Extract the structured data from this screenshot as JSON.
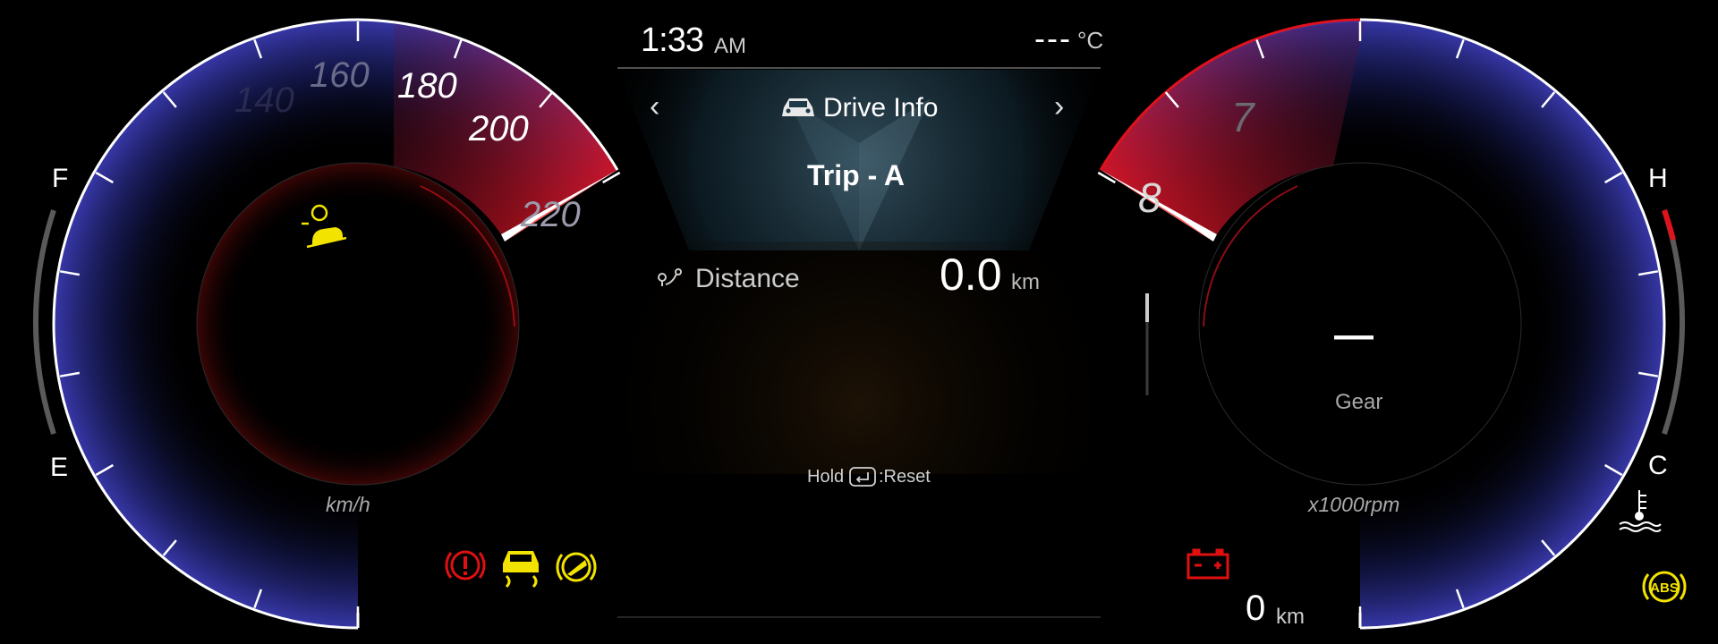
{
  "clock": {
    "time": "1:33",
    "ampm": "AM"
  },
  "outside_temp": {
    "value": "---",
    "unit": "°C"
  },
  "info_panel": {
    "title": "Drive Info",
    "prev_arrow": "‹",
    "next_arrow": "›",
    "subtitle": "Trip - A",
    "distance_label": "Distance",
    "distance_value": "0.0",
    "distance_unit": "km",
    "reset_hold": "Hold",
    "reset_action": ":Reset"
  },
  "speedometer": {
    "unit": "km/h",
    "tick_labels": [
      "140",
      "160",
      "180",
      "200",
      "220"
    ]
  },
  "tachometer": {
    "unit": "x1000rpm",
    "tick_labels": [
      "7",
      "8"
    ],
    "gear_value": "—",
    "gear_label": "Gear"
  },
  "fuel_gauge": {
    "full_label": "F",
    "empty_label": "E"
  },
  "temp_gauge": {
    "hot_label": "H",
    "cold_label": "C"
  },
  "odometer": {
    "value": "0",
    "unit": "km"
  },
  "warning_lights": {
    "left_panel": [
      "hill-descent-icon"
    ],
    "bottom_left": [
      "brake-warning-icon",
      "traction-control-icon",
      "parking-brake-icon"
    ],
    "bottom_right": [
      "battery-warning-icon",
      "abs-warning-icon"
    ],
    "temp": "coolant-temperature-icon"
  },
  "colors": {
    "accent_red": "#e0121c",
    "dial_blue": "#2a2f8c",
    "warning_amber": "#f2e300",
    "warning_red": "#e01010"
  }
}
